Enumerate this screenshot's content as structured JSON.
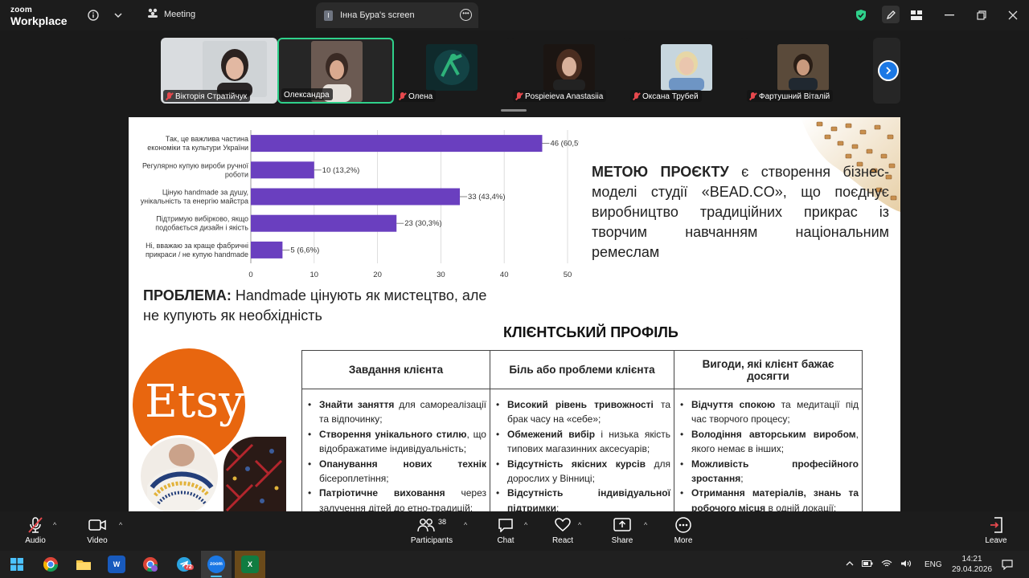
{
  "topbar": {
    "logo_line1": "zoom",
    "logo_line2": "Workplace",
    "meeting_label": "Meeting",
    "screen_tab_label": "Інна Бура's screen"
  },
  "participants": [
    {
      "name": "Вікторія Стратійчук",
      "muted": true
    },
    {
      "name": "Олександра",
      "muted": false
    },
    {
      "name": "Олена",
      "muted": true
    },
    {
      "name": "Pospieieva Anastasiia",
      "muted": true
    },
    {
      "name": "Оксана Трубей",
      "muted": true
    },
    {
      "name": "Фартушний Віталій",
      "muted": true
    }
  ],
  "chart_data": {
    "type": "bar",
    "orientation": "horizontal",
    "categories": [
      "Так, це важлива частина економіки та культури України",
      "Регулярно купую вироби ручної роботи",
      "Ціную handmade за душу, унікальність та енергію майстра",
      "Підтримую вибірково, якщо подобається дизайн і якість",
      "Ні, вважаю за краще фабричні прикраси / не купую handmade"
    ],
    "category_lines": [
      [
        "Так, це важлива частина",
        "економіки та культури України"
      ],
      [
        "Регулярно купую вироби ручної",
        "роботи"
      ],
      [
        "Ціную handmade за душу,",
        "унікальність та енергію майстра"
      ],
      [
        "Підтримую вибірково, якщо",
        "подобається дизайн і якість"
      ],
      [
        "Ні, вважаю за краще фабричні",
        "прикраси / не купую handmade"
      ]
    ],
    "values": [
      46,
      10,
      33,
      23,
      5
    ],
    "data_labels": [
      "46 (60,5%)",
      "10 (13,2%)",
      "33 (43,4%)",
      "23 (30,3%)",
      "5 (6,6%)"
    ],
    "xlim": [
      0,
      50
    ],
    "xticks": [
      0,
      10,
      20,
      30,
      40,
      50
    ],
    "grid": true,
    "bar_color": "#6a3fbf"
  },
  "slide": {
    "goal_bold": "МЕТОЮ ПРОЄКТУ",
    "goal_text": " є створення бізнес-моделі студії «BEAD.CO», що поєднує виробництво традиційних прикрас із творчим навчанням національним ремеслам",
    "problem_bold": "ПРОБЛЕМА:",
    "problem_text": "  Handmade цінують як мистецтво, але не купують як необхідність",
    "client_profile_title": "КЛІЄНТСЬКИЙ ПРОФІЛЬ",
    "etsy_logo_text": "Etsy",
    "table": {
      "headers": [
        "Завдання клієнта",
        "Біль або проблеми клієнта",
        "Вигоди, які клієнт бажає досягти"
      ],
      "col1": [
        {
          "b": "Знайти заняття",
          "t": " для самореалізації та відпочинку;"
        },
        {
          "b": "Створення унікального стилю",
          "t": ", що відображатиме індивідуальність;"
        },
        {
          "b": "Опанування нових технік",
          "t": " бісероплетіння;"
        },
        {
          "b": "Патріотичне виховання",
          "t": " через залучення дітей до етно-традицій;"
        }
      ],
      "col2": [
        {
          "b": "Високий рівень тривожності",
          "t": " та брак часу на «себе»;"
        },
        {
          "b": "Обмежений вибір",
          "t": " і низька якість типових магазинних аксесуарів;"
        },
        {
          "b": "Відсутність якісних курсів",
          "t": " для дорослих у Вінниці;"
        },
        {
          "b": "Відсутність індивідуальної підтримки",
          "t": ";"
        }
      ],
      "col3": [
        {
          "b": "Відчуття спокою",
          "t": " та медитації під час творчого процесу;"
        },
        {
          "b": "Володіння авторським виробом",
          "t": ", якого немає в інших;"
        },
        {
          "b": "Можливість професійного зростання",
          "t": ";"
        },
        {
          "b": "Отримання матеріалів, знань та робочого місця",
          "t": " в одній локації;"
        }
      ]
    }
  },
  "controls": {
    "audio": "Audio",
    "video": "Video",
    "participants": "Participants",
    "participants_count": "38",
    "chat": "Chat",
    "react": "React",
    "share": "Share",
    "more": "More",
    "leave": "Leave"
  },
  "taskbar": {
    "language": "ENG",
    "time": "14:21",
    "date": "29.04.2026",
    "telegram_badge": "72"
  },
  "colors": {
    "accent_green": "#2fd18b",
    "zoom_blue": "#1b78e5",
    "muted_red": "#e5484d",
    "etsy_orange": "#e8660f"
  }
}
